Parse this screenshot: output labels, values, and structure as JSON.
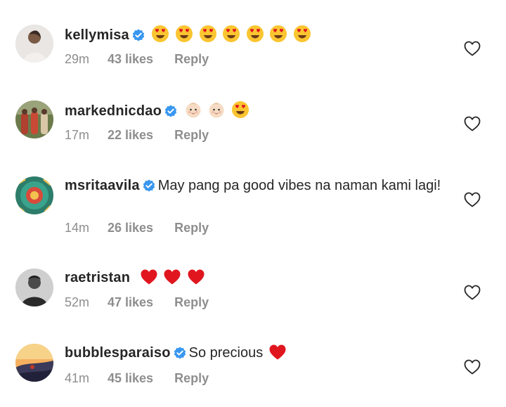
{
  "comments": [
    {
      "username": "kellymisa",
      "verified": true,
      "text": "",
      "emojis": [
        "heart-eyes-emoji",
        "heart-eyes-emoji",
        "heart-eyes-emoji",
        "heart-eyes-emoji",
        "heart-eyes-emoji",
        "heart-eyes-emoji",
        "heart-eyes-emoji"
      ],
      "time": "29m",
      "likes": "43 likes",
      "reply": "Reply"
    },
    {
      "username": "markednicdao",
      "verified": true,
      "text": "",
      "emojis": [
        "baby-emoji",
        "baby-emoji",
        "heart-eyes-emoji"
      ],
      "time": "17m",
      "likes": "22 likes",
      "reply": "Reply"
    },
    {
      "username": "msritaavila",
      "verified": true,
      "text": "May pang pa good vibes na naman kami lagi!",
      "emojis": [],
      "time": "14m",
      "likes": "26 likes",
      "reply": "Reply"
    },
    {
      "username": "raetristan",
      "verified": false,
      "text": "",
      "emojis": [
        "red-heart-emoji",
        "red-heart-emoji",
        "red-heart-emoji"
      ],
      "time": "52m",
      "likes": "47 likes",
      "reply": "Reply"
    },
    {
      "username": "bubblesparaiso",
      "verified": true,
      "text": "So precious",
      "emojis": [
        "red-heart-emoji"
      ],
      "time": "41m",
      "likes": "45 likes",
      "reply": "Reply"
    }
  ],
  "colors": {
    "text": "#262626",
    "meta": "#8e8e8e",
    "verified": "#3897f0",
    "emoji_yellow": "#fbc531",
    "heart_red": "#e0161f"
  }
}
